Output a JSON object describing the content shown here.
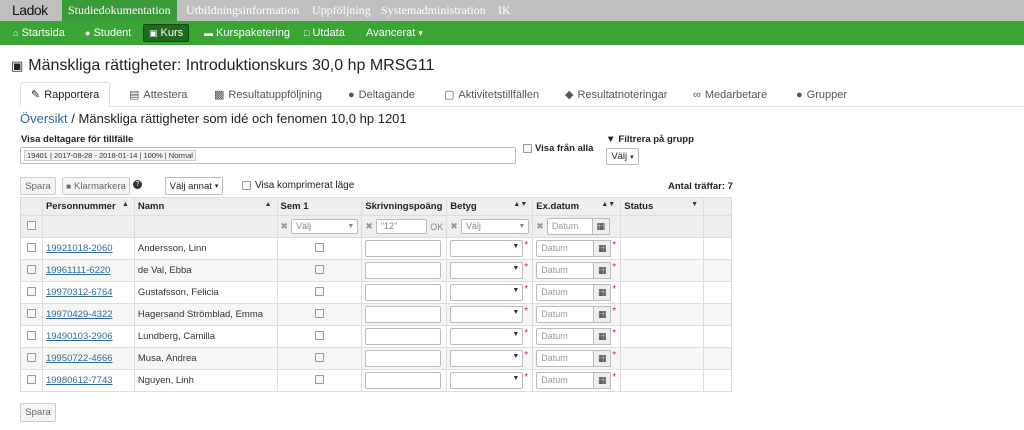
{
  "app": {
    "logo_text": "Ladok"
  },
  "topnav": [
    "Studiedokumentation",
    "Utbildningsinformation",
    "Uppföljning",
    "Systemadministration",
    "IK"
  ],
  "greennav": [
    {
      "label": "Startsida",
      "icon": "home-icon"
    },
    {
      "label": "Student",
      "icon": "user-icon"
    },
    {
      "label": "Kurs",
      "icon": "book-icon"
    },
    {
      "label": "Kurspaketering",
      "icon": "folder-icon"
    },
    {
      "label": "Utdata",
      "icon": "file-icon"
    },
    {
      "label": "Avancerat",
      "icon": "caret-down-icon"
    }
  ],
  "page": {
    "title": "Mänskliga rättigheter: Introduktionskurs 30,0 hp MRSG11"
  },
  "tabs": [
    "Rapportera",
    "Attestera",
    "Resultatuppföljning",
    "Deltagande",
    "Aktivitetstillfällen",
    "Resultatnoteringar",
    "Medarbetare",
    "Grupper"
  ],
  "breadcrumb": {
    "link": "Översikt",
    "sep": "/",
    "current": "Mänskliga rättigheter som idé och fenomen 10,0 hp 1201"
  },
  "filters": {
    "occasion_label": "Visa deltagare för tillfälle",
    "occasion_value": "19401 | 2017-08-28 - 2018-01-14 | 100% | Normal",
    "show_all_label": "Visa från alla",
    "group_filter_label": "Filtrera på grupp",
    "group_select": "Välj"
  },
  "toolbar": {
    "save": "Spara",
    "mark_ready": "Klarmarkera",
    "choose_other": "Välj annat",
    "compressed": "Visa komprimerat läge",
    "hits": "Antal träffar: 7"
  },
  "table": {
    "headers": [
      "Personnummer",
      "Namn",
      "Sem 1",
      "Skrivningspoäng",
      "Betyg",
      "Ex.datum",
      "Status"
    ],
    "filter_row": {
      "sem_placeholder": "Välj",
      "score_placeholder": "\"12\"",
      "score_ok": "OK",
      "grade_placeholder": "Välj",
      "date_placeholder": "Datum"
    },
    "date_placeholder": "Datum",
    "rows": [
      {
        "pnr": "19921018-2060",
        "name": "Andersson, Linn"
      },
      {
        "pnr": "19961111-6220",
        "name": "de Val, Ebba"
      },
      {
        "pnr": "19970312-6764",
        "name": "Gustafsson, Felicia"
      },
      {
        "pnr": "19970429-4322",
        "name": "Hagersand Strömblad, Emma"
      },
      {
        "pnr": "19490103-2906",
        "name": "Lundberg, Camilla"
      },
      {
        "pnr": "19950722-4666",
        "name": "Musa, Andrea"
      },
      {
        "pnr": "19980612-7743",
        "name": "Nguyen, Linh"
      }
    ]
  },
  "footer": {
    "save": "Spara"
  }
}
